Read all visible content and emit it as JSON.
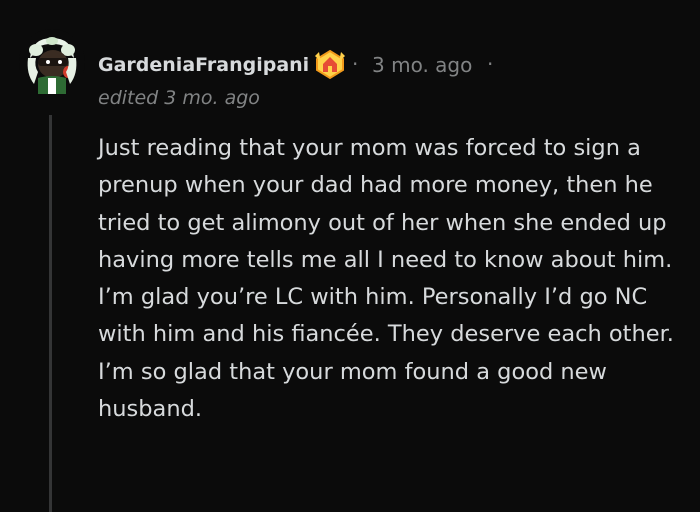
{
  "comment": {
    "author": "GardeniaFrangipani",
    "separator": "·",
    "timestamp": "3 mo. ago",
    "edited": "edited 3 mo. ago",
    "body": "Just reading that your mom was forced to sign a prenup when your dad had more money, then he tried to get alimony out of her when she ended up having more tells me all I need to know about him. I’m glad you’re LC with him. Personally I’d go NC with him and his fiancée. They deserve each other. I’m so glad that your mom found a good new husband."
  },
  "icons": {
    "avatar": "user-avatar-icon",
    "flair": "achievement-badge-icon"
  },
  "colors": {
    "background": "#0b0b0b",
    "text": "#d7dadc",
    "muted": "#818384",
    "thread_line": "#343536"
  }
}
